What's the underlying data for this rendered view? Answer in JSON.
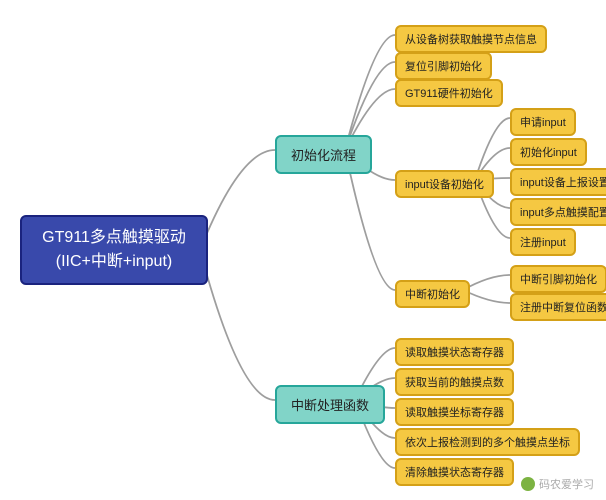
{
  "root": {
    "label": "GT911多点触摸驱动\n(IIC+中断+input)"
  },
  "branches": {
    "init": {
      "label": "初始化流程"
    },
    "irq": {
      "label": "中断处理函数"
    }
  },
  "init_children": {
    "devtree": {
      "label": "从设备树获取触摸节点信息"
    },
    "reset": {
      "label": "复位引脚初始化"
    },
    "hw": {
      "label": "GT911硬件初始化"
    },
    "input": {
      "label": "input设备初始化"
    },
    "irqinit": {
      "label": "中断初始化"
    }
  },
  "input_children": {
    "alloc": {
      "label": "申请input"
    },
    "init": {
      "label": "初始化input"
    },
    "report": {
      "label": "input设备上报设置"
    },
    "multi": {
      "label": "input多点触摸配置"
    },
    "reg": {
      "label": "注册input"
    }
  },
  "irqinit_children": {
    "pin": {
      "label": "中断引脚初始化"
    },
    "regfn": {
      "label": "注册中断复位函数"
    }
  },
  "irq_children": {
    "readstatus": {
      "label": "读取触摸状态寄存器"
    },
    "count": {
      "label": "获取当前的触摸点数"
    },
    "readcoord": {
      "label": "读取触摸坐标寄存器"
    },
    "report": {
      "label": "依次上报检测到的多个触摸点坐标"
    },
    "clear": {
      "label": "清除触摸状态寄存器"
    }
  },
  "watermark": {
    "label": "码农爱学习"
  }
}
